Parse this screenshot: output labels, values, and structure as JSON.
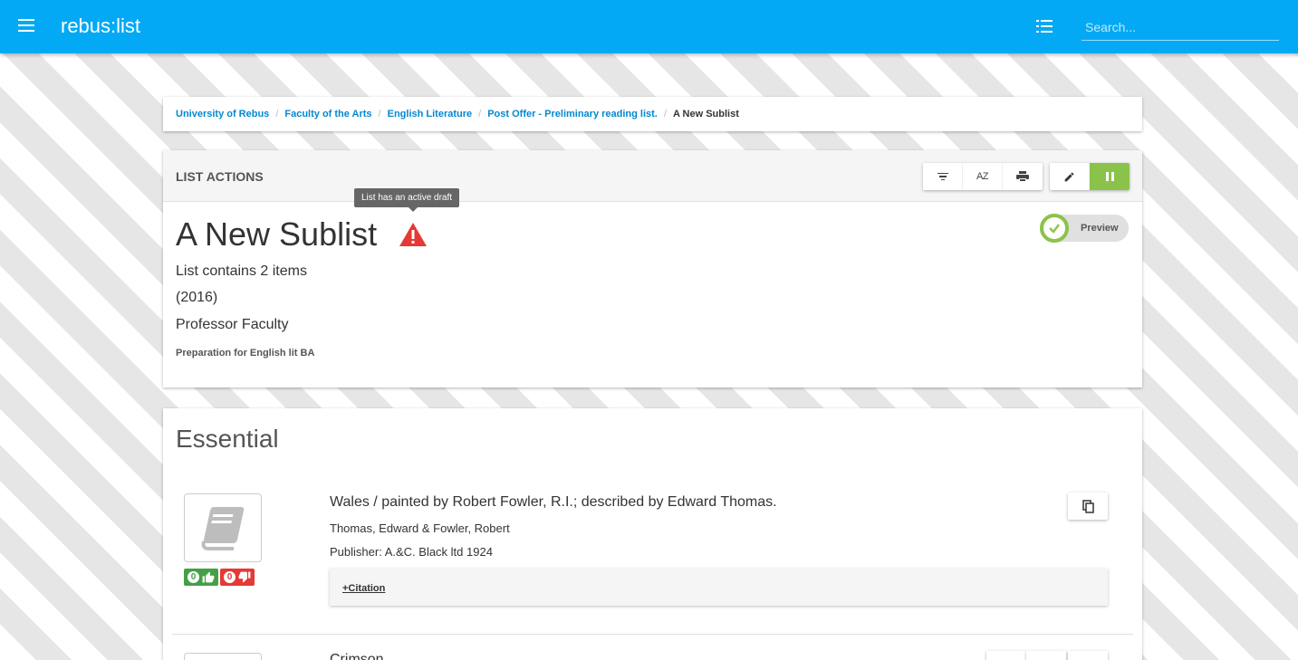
{
  "header": {
    "app_title": "rebus:list",
    "search_placeholder": "Search..."
  },
  "breadcrumb": [
    "University of Rebus",
    "Faculty of the Arts",
    "English Literature",
    "Post Offer - Preliminary reading list.",
    "A New Sublist"
  ],
  "list_actions": {
    "title": "LIST ACTIONS",
    "sort_label": "AZ",
    "tooltip": "List has an active draft"
  },
  "list": {
    "title": "A New Sublist",
    "item_count_text": "List contains 2 items",
    "year": "(2016)",
    "owner": "Professor Faculty",
    "description": "Preparation for English lit BA",
    "preview_label": "Preview"
  },
  "section": {
    "title": "Essential",
    "items": [
      {
        "title": "Wales / painted by Robert Fowler, R.I.; described by Edward Thomas.",
        "authors": "Thomas, Edward & Fowler, Robert",
        "publisher": "Publisher: A.&C. Black ltd 1924",
        "likes": "0",
        "dislikes": "0",
        "citation_link": "+Citation"
      },
      {
        "title": "Crimson"
      }
    ]
  },
  "colors": {
    "header_blue": "#03a9f4",
    "accent_green": "#8bc34a",
    "warning_red": "#e53935",
    "link_blue": "#0288d1"
  },
  "icons": [
    "menu-icon",
    "list-view-icon",
    "filter-icon",
    "sort-az-icon",
    "print-icon",
    "edit-icon",
    "pause-icon",
    "warning-icon",
    "check-circle-icon",
    "book-icon",
    "thumbs-up-icon",
    "thumbs-down-icon",
    "copy-icon"
  ]
}
